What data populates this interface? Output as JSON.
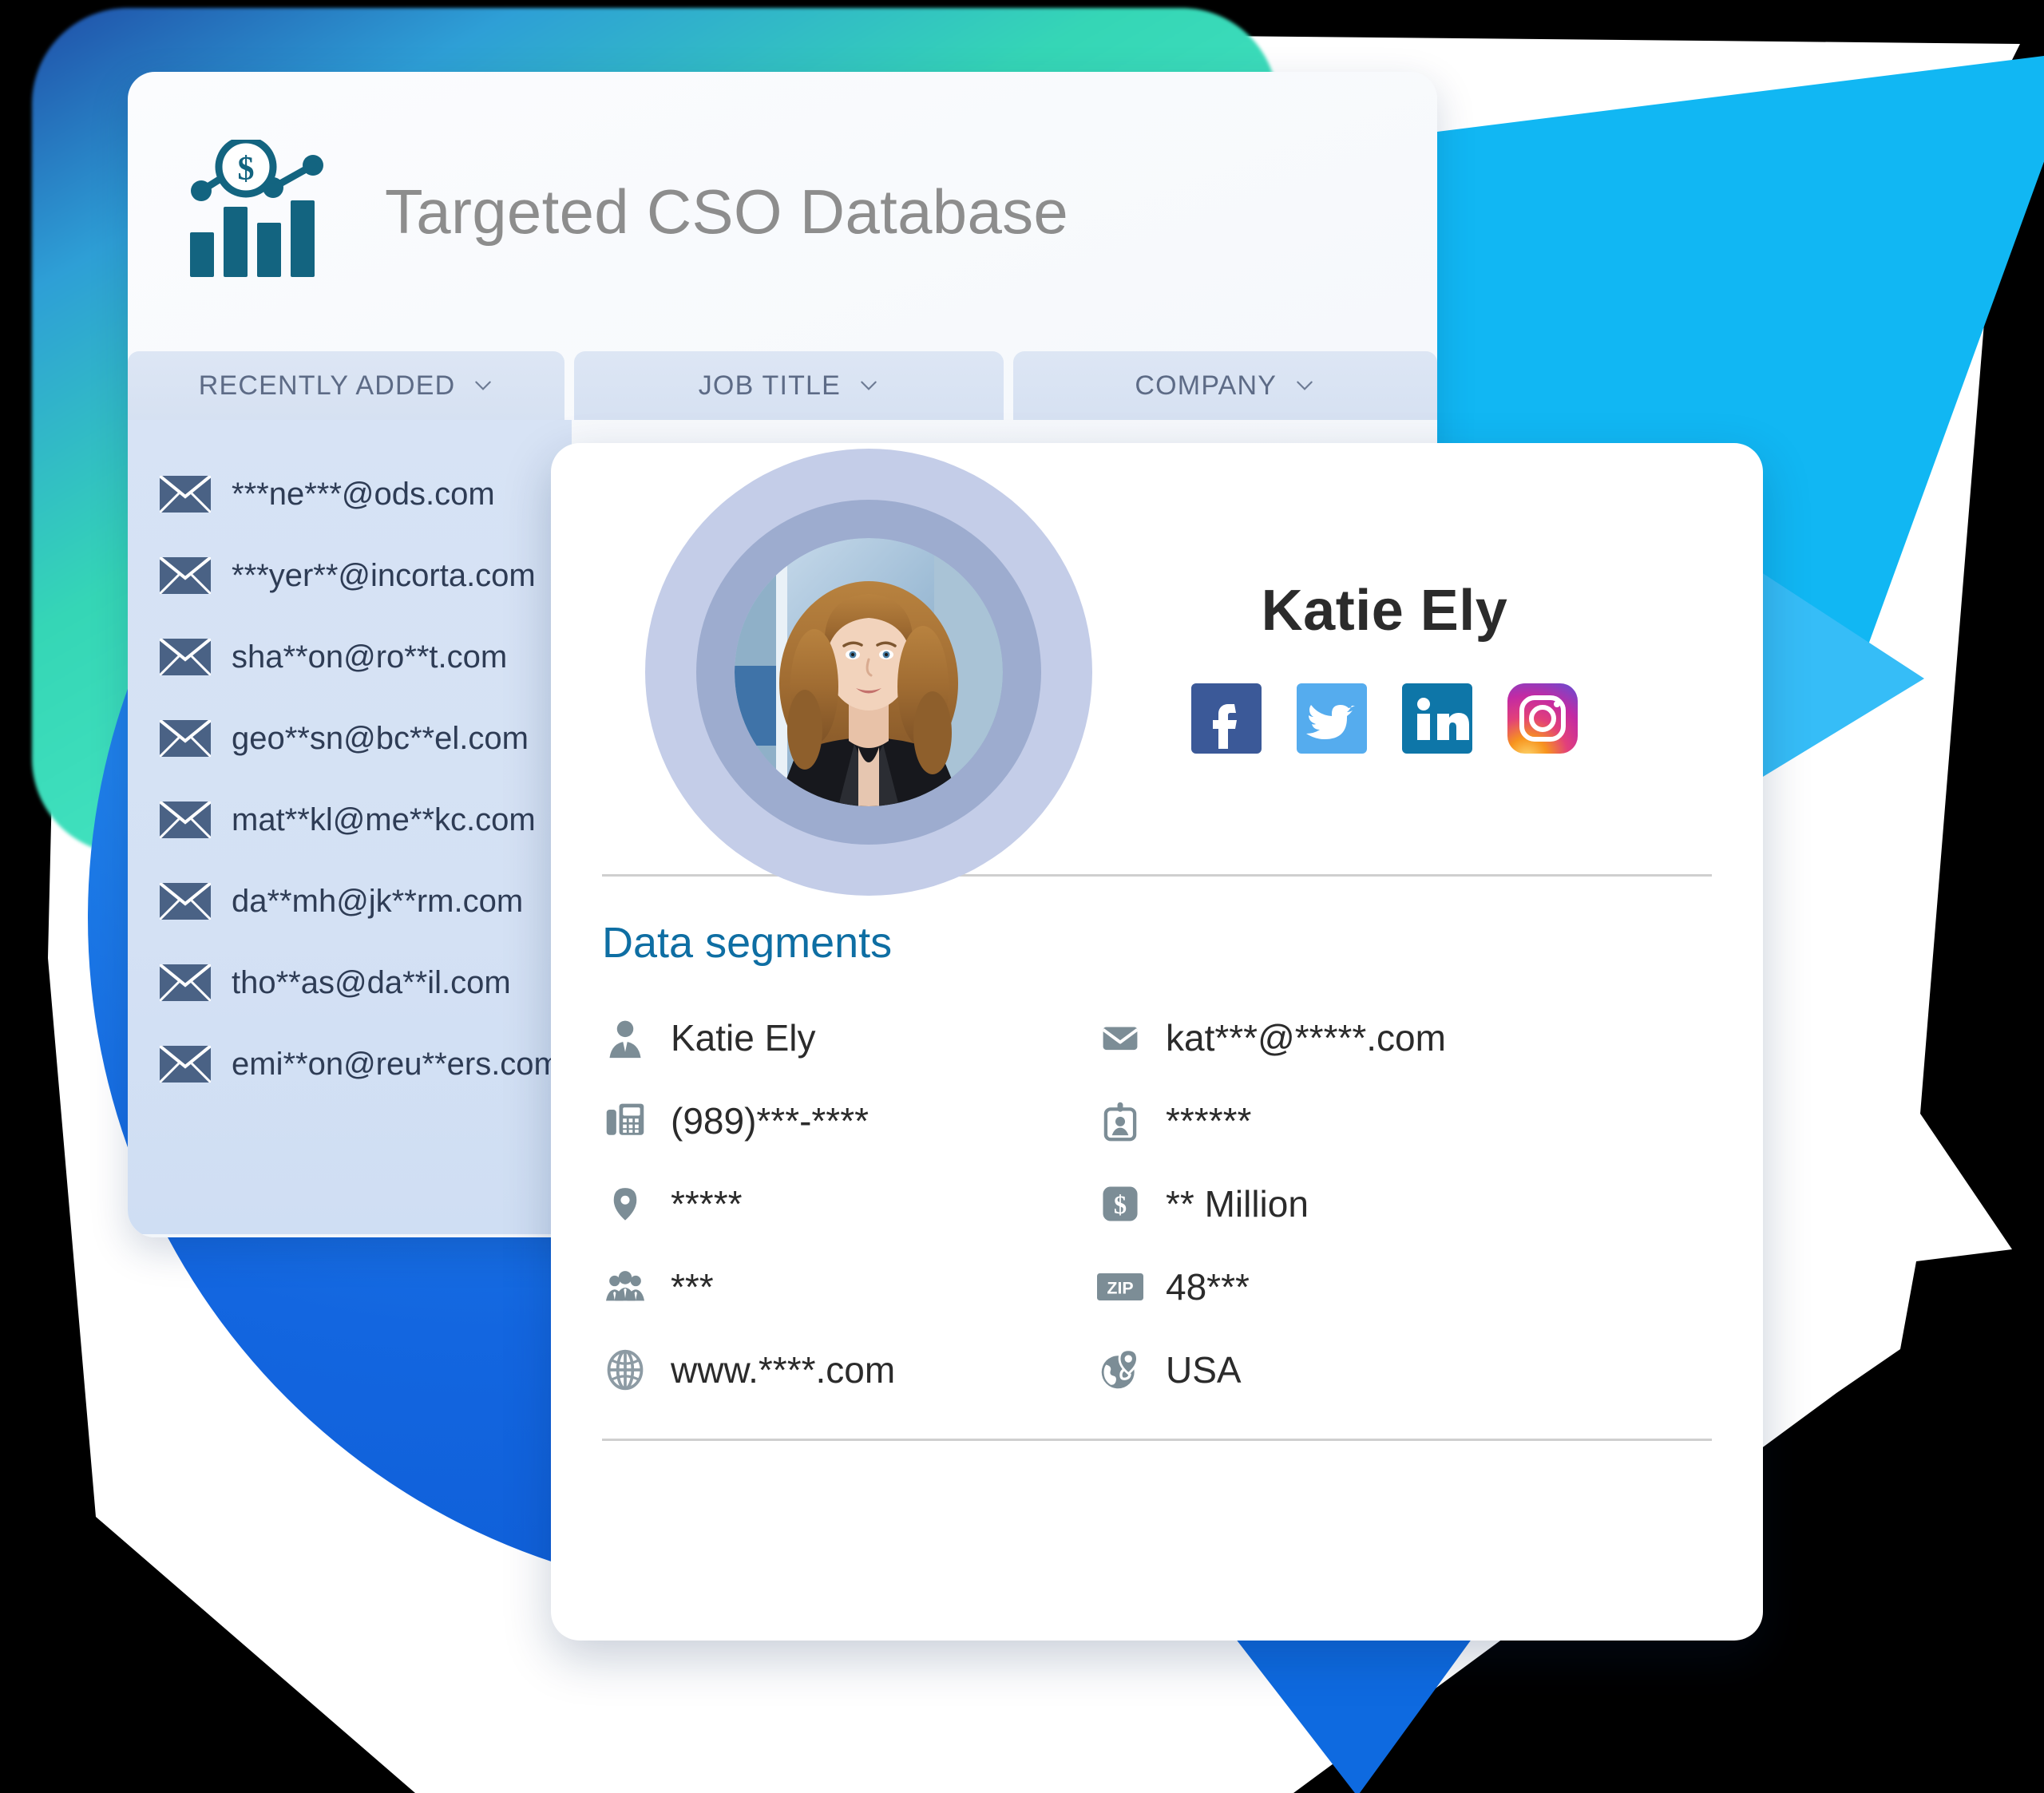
{
  "theme": {
    "accent_blue": "#0e6ea3",
    "logo_teal": "#136480",
    "cyan": "#11b7f3",
    "blue": "#0e6ae0",
    "panel_blue": "#d4e1f4",
    "text_dark": "#2b2b2b"
  },
  "header": {
    "title": "Targeted CSO Database",
    "logo_icon": "bar-chart-dollar-icon"
  },
  "table": {
    "columns": [
      {
        "label": "RECENTLY ADDED",
        "sort_icon": "chevron-down-icon"
      },
      {
        "label": "JOB TITLE",
        "sort_icon": "chevron-down-icon"
      },
      {
        "label": "COMPANY",
        "sort_icon": "chevron-down-icon"
      }
    ],
    "emails": [
      {
        "icon": "envelope-icon",
        "value": "***ne***@ods.com"
      },
      {
        "icon": "envelope-icon",
        "value": "***yer**@incorta.com"
      },
      {
        "icon": "envelope-icon",
        "value": "sha**on@ro**t.com"
      },
      {
        "icon": "envelope-icon",
        "value": "geo**sn@bc**el.com"
      },
      {
        "icon": "envelope-icon",
        "value": "mat**kl@me**kc.com"
      },
      {
        "icon": "envelope-icon",
        "value": "da**mh@jk**rm.com"
      },
      {
        "icon": "envelope-icon",
        "value": "tho**as@da**il.com"
      },
      {
        "icon": "envelope-icon",
        "value": "emi**on@reu**ers.com"
      }
    ]
  },
  "profile": {
    "avatar_alt": "portrait of a woman with curly hair in a black blazer",
    "name": "Katie Ely",
    "socials": [
      {
        "name": "facebook-icon",
        "label": "Facebook",
        "color": "#3b5998"
      },
      {
        "name": "twitter-icon",
        "label": "Twitter",
        "color": "#55acee"
      },
      {
        "name": "linkedin-icon",
        "label": "LinkedIn",
        "color": "#0e76a8"
      },
      {
        "name": "instagram-icon",
        "label": "Instagram",
        "color": "#d62976"
      }
    ],
    "segments_title": "Data segments",
    "segments": [
      {
        "icon": "person-icon",
        "value": "Katie Ely"
      },
      {
        "icon": "email-icon",
        "value": "kat***@*****.com"
      },
      {
        "icon": "fax-phone-icon",
        "value": "(989)***-****"
      },
      {
        "icon": "id-badge-icon",
        "value": "******"
      },
      {
        "icon": "location-pin-icon",
        "value": "*****"
      },
      {
        "icon": "dollar-icon",
        "value": "** Million"
      },
      {
        "icon": "people-group-icon",
        "value": "***"
      },
      {
        "icon": "zip-icon",
        "value": "48***"
      },
      {
        "icon": "globe-icon",
        "value": "www.****.com"
      },
      {
        "icon": "globe-pin-icon",
        "value": "USA"
      }
    ]
  }
}
